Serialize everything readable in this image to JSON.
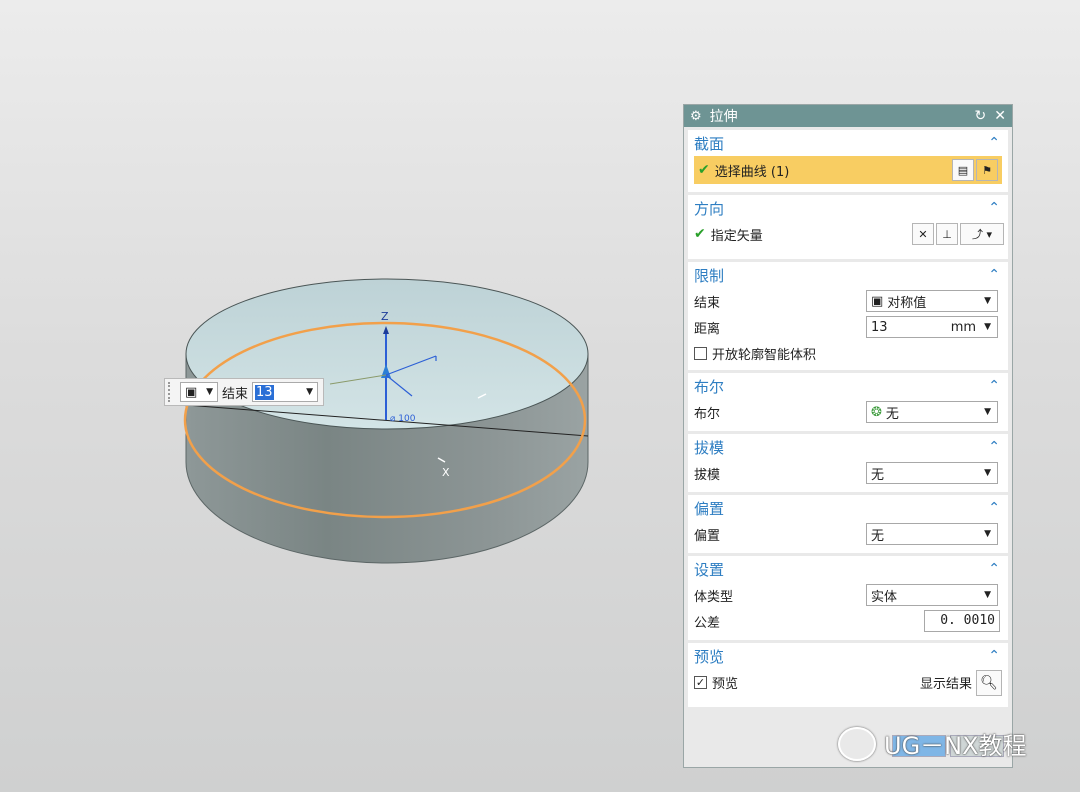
{
  "viewport": {
    "triad_axis_z": "Z",
    "triad_axis_x": "X",
    "diameter_label": "⌀ 100",
    "floating": {
      "end_label": "结束",
      "value": "13"
    }
  },
  "dialog": {
    "title": "拉伸",
    "sections": {
      "section": {
        "title": "截面",
        "row_label": "选择曲线 (1)"
      },
      "direction": {
        "title": "方向",
        "row_label": "指定矢量"
      },
      "limits": {
        "title": "限制",
        "end_label": "结束",
        "end_value": "对称值",
        "distance_label": "距离",
        "distance_value": "13",
        "distance_unit": "mm",
        "open_profile_label": "开放轮廓智能体积"
      },
      "boolean": {
        "title": "布尔",
        "label": "布尔",
        "value": "无"
      },
      "draft": {
        "title": "拔模",
        "label": "拔模",
        "value": "无"
      },
      "offset": {
        "title": "偏置",
        "label": "偏置",
        "value": "无"
      },
      "settings": {
        "title": "设置",
        "body_type_label": "体类型",
        "body_type_value": "实体",
        "tolerance_label": "公差",
        "tolerance_value": "0. 0010"
      },
      "preview": {
        "title": "预览",
        "preview_label": "预览",
        "show_result_label": "显示结果"
      }
    }
  },
  "watermark": {
    "text": "UG－NX教程"
  },
  "colors": {
    "title_bar": "#6e9494",
    "section_header": "#2e7ec2",
    "highlight": "#f8cd62",
    "curve": "#f2a04a",
    "cylinder_top": "#c6dadd",
    "cylinder_side": "#8a9494"
  },
  "icons": [
    "gear-icon",
    "reset-icon",
    "close-icon",
    "collapse-icon",
    "checkmark-icon",
    "curve-rule-icon",
    "sketch-section-icon",
    "reverse-direction-icon",
    "vector-constructor-icon",
    "vector-type-icon",
    "solid-body-icon",
    "unite-icon",
    "magnifier-icon"
  ]
}
